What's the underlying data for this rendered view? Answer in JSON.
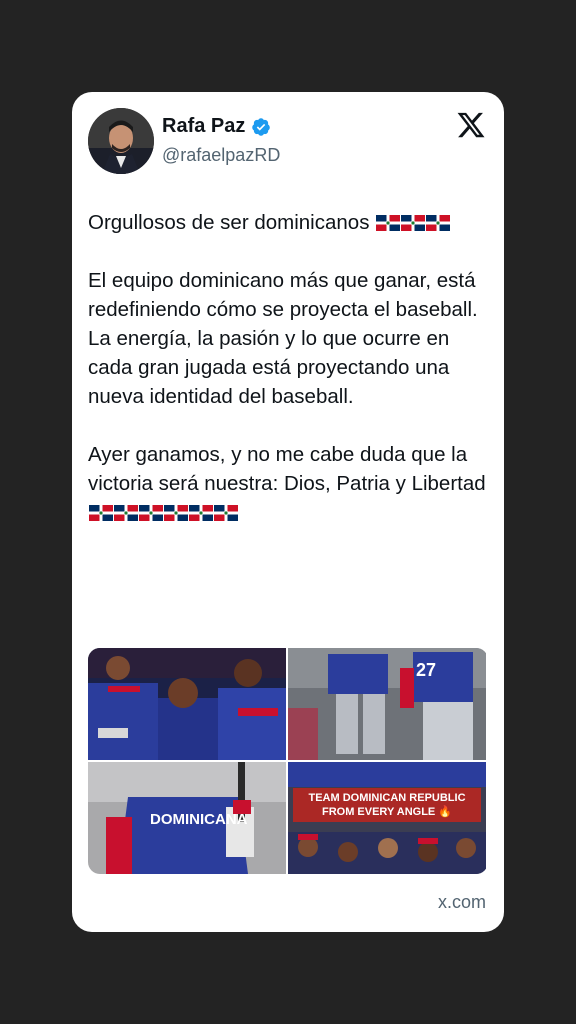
{
  "author": {
    "name": "Rafa Paz",
    "handle": "@rafaelpazRD",
    "verified": true,
    "avatar_icon": "profile-photo"
  },
  "tweet": {
    "paragraphs": [
      "Orgullosos de ser dominicanos",
      "El equipo dominicano más que ganar, está redefiniendo cómo se proyecta el baseball. La energía, la pasión y lo que ocurre en cada gran jugada está proyectando una nueva identidad del baseball.",
      "Ayer ganamos, y no me cabe duda que la victoria será nuestra: Dios, Patria y Libertad"
    ],
    "flag_emoji_counts": [
      3,
      0,
      6
    ]
  },
  "media": {
    "overlay_text": "TEAM DOMINICAN REPUBLIC FROM EVERY ANGLE 🔥",
    "jersey_text": "DOMINICANA",
    "player_number": "27"
  },
  "source_label": "x.com",
  "colors": {
    "background": "#232323",
    "card": "#ffffff",
    "text": "#0f1419",
    "secondary_text": "#536471",
    "verified_blue": "#1d9bf0",
    "team_blue": "#2b3d9c",
    "team_red": "#c8102e"
  }
}
